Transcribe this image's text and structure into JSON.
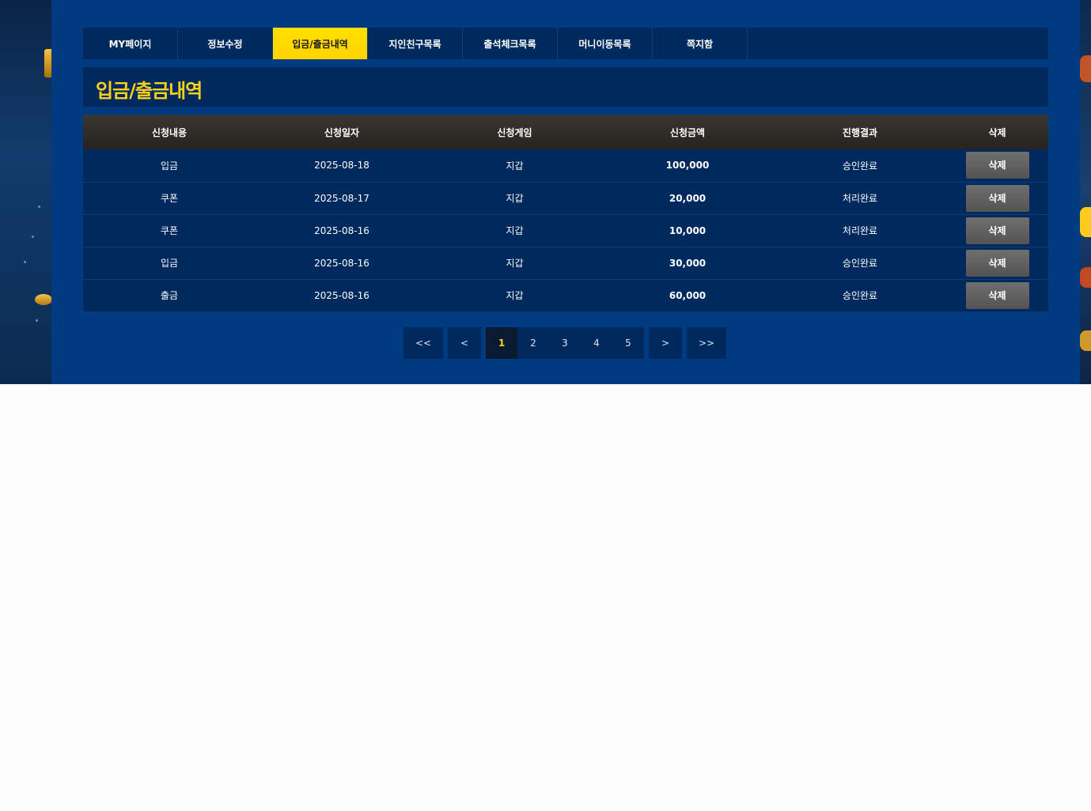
{
  "tabs": [
    {
      "label": "MY페이지",
      "active": false
    },
    {
      "label": "정보수정",
      "active": false
    },
    {
      "label": "입금/출금내역",
      "active": true
    },
    {
      "label": "지인친구목록",
      "active": false
    },
    {
      "label": "출석체크목록",
      "active": false
    },
    {
      "label": "머니이동목록",
      "active": false
    },
    {
      "label": "쪽지함",
      "active": false
    }
  ],
  "page_title": "입금/출금내역",
  "table": {
    "columns": [
      "신청내용",
      "신청일자",
      "신청게임",
      "신청금액",
      "진행결과",
      "삭제"
    ],
    "rows": [
      {
        "type": "입금",
        "date": "2025-08-18",
        "game": "지갑",
        "amount": "100,000",
        "result": "승인완료",
        "action": "삭제"
      },
      {
        "type": "쿠폰",
        "date": "2025-08-17",
        "game": "지갑",
        "amount": "20,000",
        "result": "처리완료",
        "action": "삭제"
      },
      {
        "type": "쿠폰",
        "date": "2025-08-16",
        "game": "지갑",
        "amount": "10,000",
        "result": "처리완료",
        "action": "삭제"
      },
      {
        "type": "입금",
        "date": "2025-08-16",
        "game": "지갑",
        "amount": "30,000",
        "result": "승인완료",
        "action": "삭제"
      },
      {
        "type": "출금",
        "date": "2025-08-16",
        "game": "지갑",
        "amount": "60,000",
        "result": "승인완료",
        "action": "삭제"
      }
    ]
  },
  "pagination": {
    "first": "<<",
    "prev": "<",
    "pages": [
      "1",
      "2",
      "3",
      "4",
      "5"
    ],
    "current": "1",
    "next": ">",
    "last": ">>"
  },
  "colors": {
    "panel": "#003a80",
    "bar": "#002a5e",
    "accent": "#ffd21a",
    "amount": "#ffc61a",
    "header": "#2f2c28"
  }
}
